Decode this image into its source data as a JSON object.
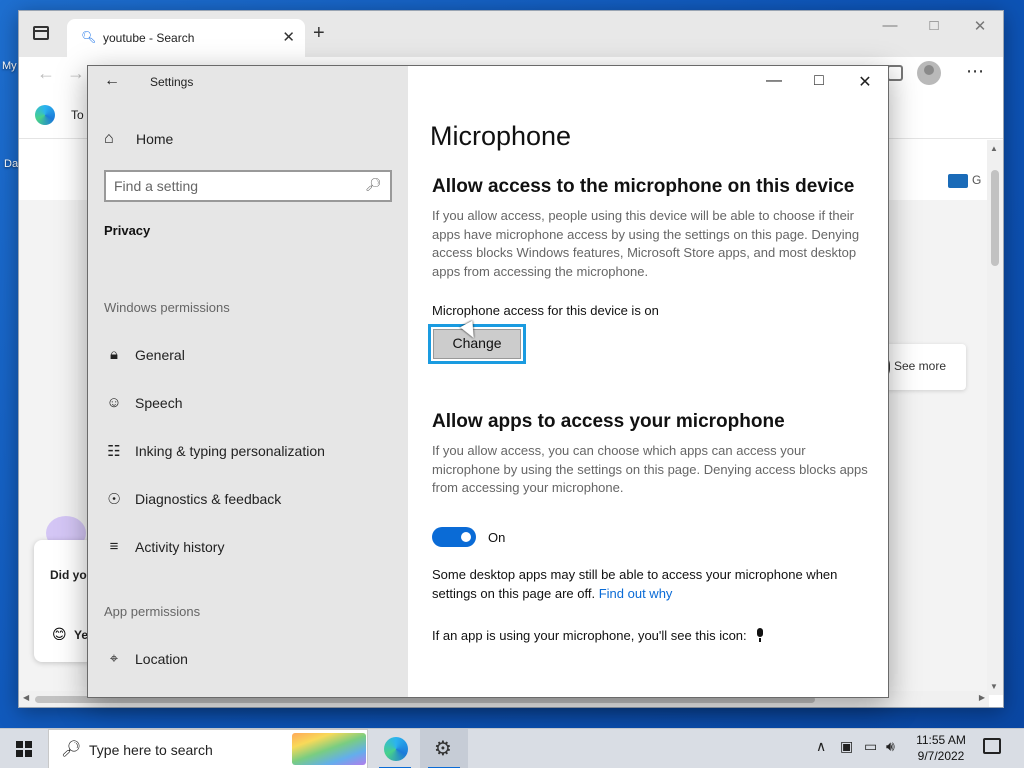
{
  "desktop": {
    "left_label_top": "My",
    "left_label_bottom": "Da"
  },
  "browser": {
    "tab": {
      "title": "youtube - Search",
      "favicon_icon": "search-icon"
    },
    "bookmark_text": "To",
    "see_more": "See more",
    "g_badge": "G",
    "chat_card": {
      "question": "Did you you we search",
      "answer": "Ye"
    }
  },
  "settings": {
    "window_title": "Settings",
    "nav": {
      "home": "Home",
      "search_placeholder": "Find a setting",
      "current": "Privacy",
      "group_windows": "Windows permissions",
      "group_app": "App permissions",
      "items": [
        {
          "label": "General",
          "icon": "lock-icon"
        },
        {
          "label": "Speech",
          "icon": "speech-icon"
        },
        {
          "label": "Inking & typing personalization",
          "icon": "clipboard-icon"
        },
        {
          "label": "Diagnostics & feedback",
          "icon": "feedback-icon"
        },
        {
          "label": "Activity history",
          "icon": "timeline-icon"
        },
        {
          "label": "Location",
          "icon": "location-icon"
        }
      ]
    },
    "content": {
      "page_title": "Microphone",
      "section1_title": "Allow access to the microphone on this device",
      "section1_desc": "If you allow access, people using this device will be able to choose if their apps have microphone access by using the settings on this page. Denying access blocks Windows features, Microsoft Store apps, and most desktop apps from accessing the microphone.",
      "status_text": "Microphone access for this device is on",
      "change_button": "Change",
      "section2_title": "Allow apps to access your microphone",
      "section2_desc": "If you allow access, you can choose which apps can access your microphone by using the settings on this page. Denying access blocks apps from accessing your microphone.",
      "toggle_state": "On",
      "toggle_on": true,
      "note_text": "Some desktop apps may still be able to access your microphone when settings on this page are off.",
      "note_link": "Find out why",
      "icon_note": "If an app is using your microphone, you'll see this icon:"
    }
  },
  "taskbar": {
    "search_placeholder": "Type here to search",
    "clock_time": "11:55 AM",
    "clock_date": "9/7/2022"
  },
  "colors": {
    "accent": "#0a6bd6",
    "focus_ring": "#1a9be0",
    "nav_bg": "#e6e6e6"
  }
}
